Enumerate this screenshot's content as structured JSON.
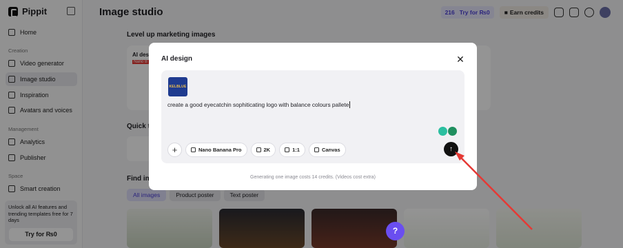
{
  "brand": {
    "name": "Pippit"
  },
  "sidebar": {
    "items": [
      {
        "label": "Home"
      },
      {
        "label": "Video generator"
      },
      {
        "label": "Image studio"
      },
      {
        "label": "Inspiration"
      },
      {
        "label": "Avatars and voices"
      },
      {
        "label": "Analytics"
      },
      {
        "label": "Publisher"
      },
      {
        "label": "Smart creation"
      }
    ],
    "sections": {
      "creation": "Creation",
      "management": "Management",
      "space": "Space"
    },
    "promo": {
      "text": "Unlock all AI features and trending templates free for 7 days",
      "button": "Try for ₨0"
    }
  },
  "header": {
    "title": "Image studio",
    "credits": "216",
    "try_label": "Try for ₨0",
    "earn_label": "Earn credits",
    "lang": "EN"
  },
  "main": {
    "level_up": "Level up marketing images",
    "card_partial": "AI des",
    "card_badge": "Nano B",
    "quick_partial": "Quick t",
    "find_partial": "Find ins",
    "chips": [
      "All images",
      "Product poster",
      "Text poster"
    ]
  },
  "modal": {
    "title": "AI design",
    "reference_image_text": "KELBLUE",
    "prompt": "create a good eyecatchin sophiticating logo with balance colours pallete",
    "model": "Nano Banana Pro",
    "resolution": "2K",
    "ratio": "1:1",
    "canvas": "Canvas",
    "footnote": "Generating one image costs 14 credits. (Videos cost extra)"
  },
  "colors": {
    "accent": "#4b3fd6",
    "annotation": "#e53935",
    "send": "#111111"
  }
}
